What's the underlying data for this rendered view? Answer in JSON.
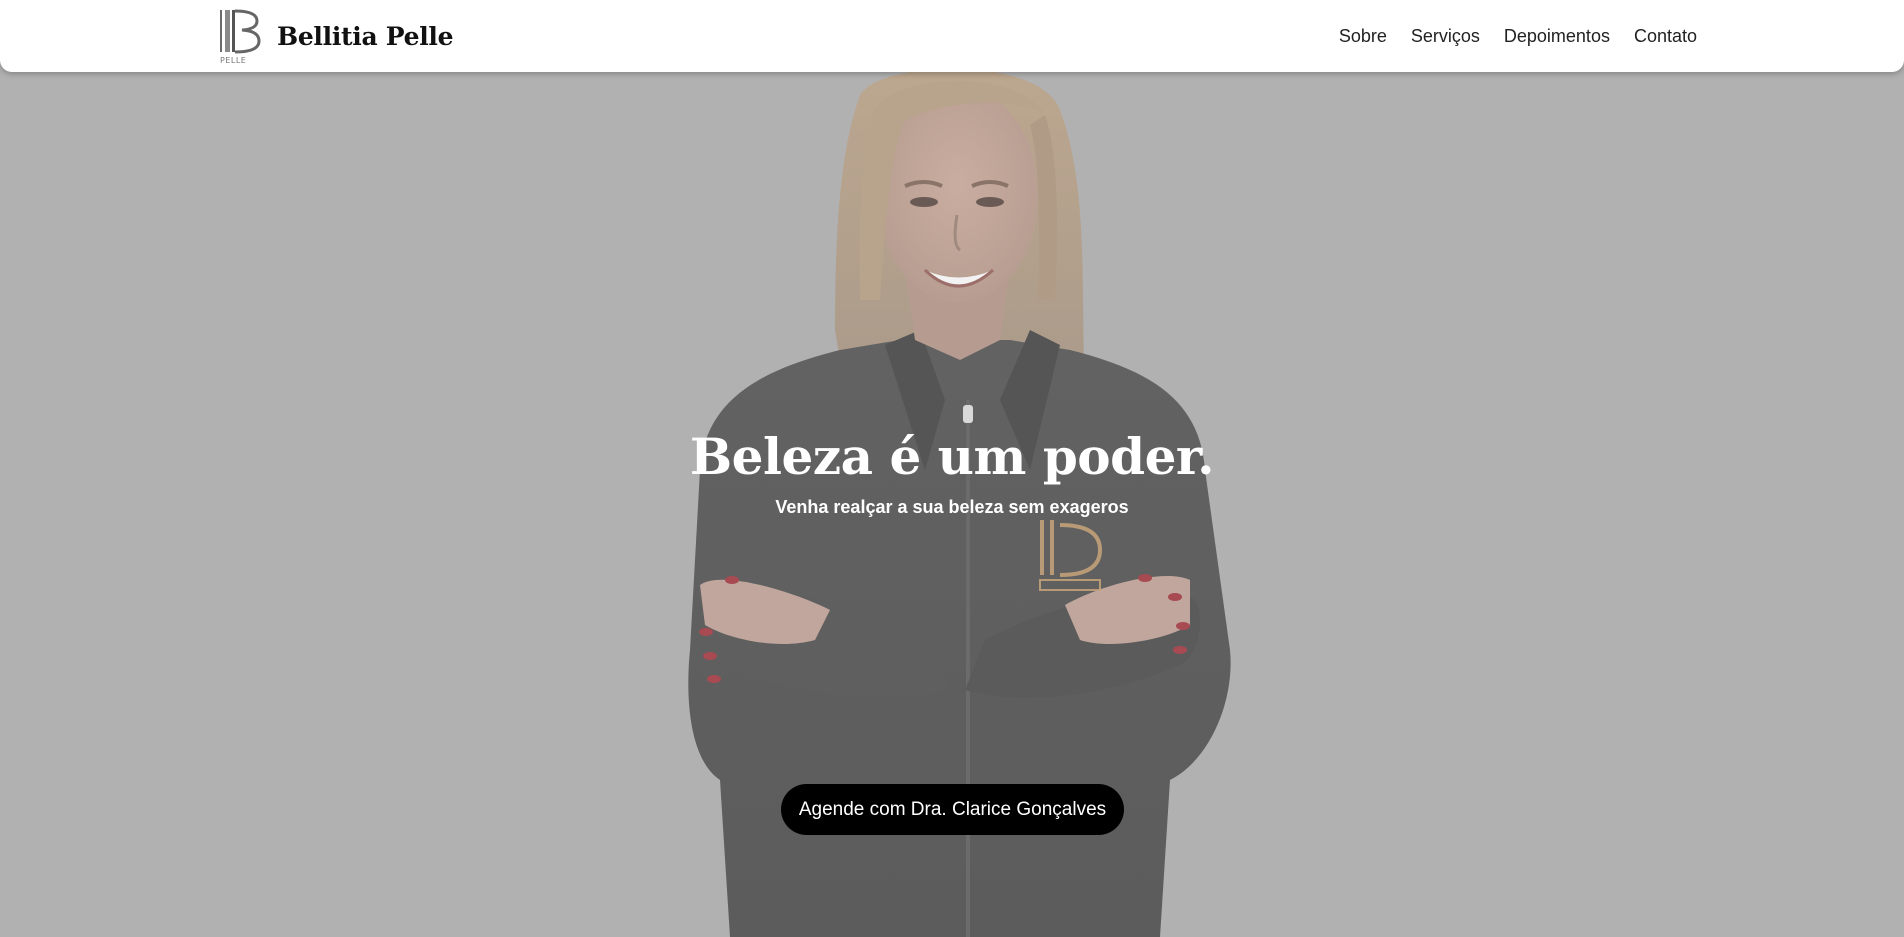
{
  "header": {
    "brand_name": "Bellitia Pelle",
    "logo_icon": "bellitia-pelle-logo",
    "nav": [
      {
        "label": "Sobre"
      },
      {
        "label": "Serviços"
      },
      {
        "label": "Depoimentos"
      },
      {
        "label": "Contato"
      }
    ]
  },
  "hero": {
    "title": "Beleza é um poder.",
    "subtitle": "Venha realçar a sua beleza sem exageros",
    "cta_label": "Agende com Dra. Clarice Gonçalves",
    "photo": "doctor-portrait-photo"
  },
  "colors": {
    "background": "#b1b1b1",
    "header": "#ffffff",
    "button": "#000000",
    "button_text": "#ffffff",
    "jacket": "#5a5a5a",
    "hair": "#c4a88a"
  }
}
